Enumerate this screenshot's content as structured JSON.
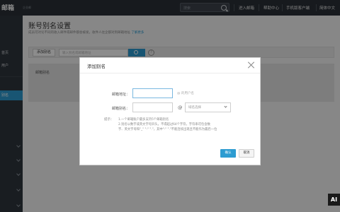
{
  "topbar": {
    "logo": "邮箱",
    "logo_sub": "企业邮",
    "search_placeholder": "搜索",
    "nav": [
      "进入邮箱",
      "帮助中心",
      "手机版客户端",
      "简体中文"
    ]
  },
  "sidebar": {
    "items": [
      "首页",
      "用户",
      "邮件",
      "别名"
    ],
    "active_index": 3
  },
  "main": {
    "title": "账号别名设置",
    "desc": "成员可对论不同的收入邮件或邮件都会被发，收件人往企都对到邮箱地址",
    "desc_link": "了解更多",
    "add_button": "添加别名",
    "search_placeholder": "输入别名或邮箱地址",
    "table_header": "邮箱别名"
  },
  "dialog": {
    "title": "添加别名",
    "email_label": "邮箱地址：",
    "email_value": "",
    "email_hint": "@ 的用户名",
    "alias_label": "邮箱别名：",
    "alias_value": "",
    "at": "@",
    "domain_select": "域名选择",
    "tips_label": "提示：",
    "tips": [
      "1.一个邮箱账户最多支持5个邮箱别名",
      "2.别名以数字或英文字母开头，不得超过64个字符，字符串可包含数",
      "字、英文字母和\"_\" \"-\" \".\"，其中\"-\" \".\"不能连续出现且不能作为最后一位"
    ],
    "confirm": "确认",
    "cancel": "取消"
  },
  "corner_badge": "AI",
  "colors": {
    "accent": "#2d9cd1",
    "topbar": "#2b3138",
    "sidebar": "#2f363d"
  }
}
